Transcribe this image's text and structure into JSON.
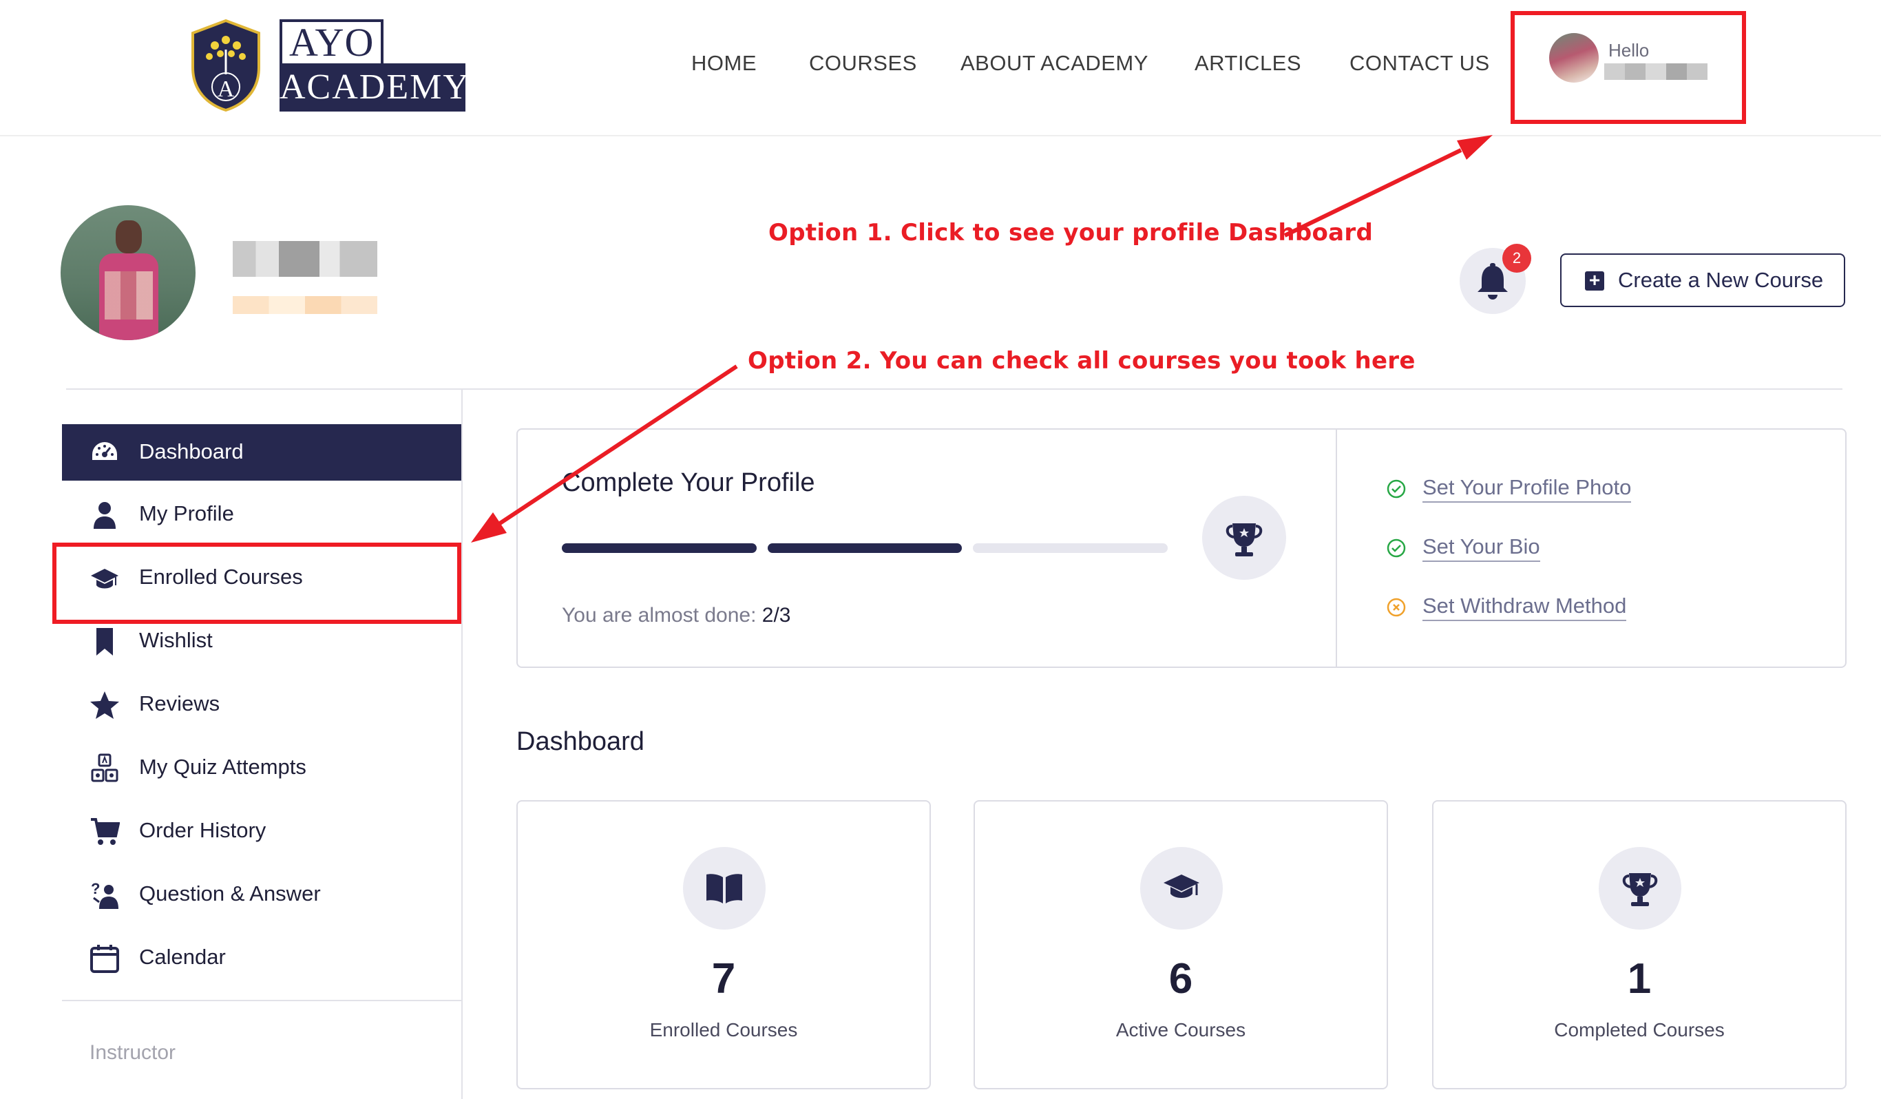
{
  "brand": {
    "line1": "AYO",
    "line2": "ACADEMY"
  },
  "nav": {
    "items": [
      "HOME",
      "COURSES",
      "ABOUT ACADEMY",
      "ARTICLES",
      "CONTACT US"
    ]
  },
  "user_menu": {
    "greeting": "Hello"
  },
  "annotations": {
    "option1": "Option 1. Click to see your profile Dashboard",
    "option2": "Option 2. You can check all courses you took here"
  },
  "notifications": {
    "count": "2",
    "icon": "bell-icon"
  },
  "actions": {
    "create_course": "Create a New Course"
  },
  "sidebar": {
    "items": [
      {
        "label": "Dashboard",
        "icon": "dashboard-gauge-icon",
        "active": true
      },
      {
        "label": "My Profile",
        "icon": "user-icon"
      },
      {
        "label": "Enrolled Courses",
        "icon": "graduation-cap-icon"
      },
      {
        "label": "Wishlist",
        "icon": "bookmark-icon"
      },
      {
        "label": "Reviews",
        "icon": "star-icon"
      },
      {
        "label": "My Quiz Attempts",
        "icon": "quiz-blocks-icon"
      },
      {
        "label": "Order History",
        "icon": "cart-icon"
      },
      {
        "label": "Question & Answer",
        "icon": "question-answer-icon"
      },
      {
        "label": "Calendar",
        "icon": "calendar-icon"
      }
    ],
    "section_label": "Instructor"
  },
  "profile_completion": {
    "title": "Complete Your Profile",
    "progress_done": 2,
    "progress_total": 3,
    "status_prefix": "You are almost done:",
    "status_value": "2/3",
    "checklist": [
      {
        "label": "Set Your Profile Photo",
        "status": "done",
        "color": "#27a745"
      },
      {
        "label": "Set Your Bio",
        "status": "done",
        "color": "#27a745"
      },
      {
        "label": "Set Withdraw Method",
        "status": "pending",
        "color": "#f0a12b"
      }
    ]
  },
  "dashboard": {
    "title": "Dashboard",
    "stats": [
      {
        "value": "7",
        "label": "Enrolled Courses",
        "icon": "open-book-icon"
      },
      {
        "value": "6",
        "label": "Active Courses",
        "icon": "graduation-cap-icon"
      },
      {
        "value": "1",
        "label": "Completed Courses",
        "icon": "trophy-icon"
      }
    ]
  },
  "colors": {
    "primary": "#26284f",
    "annotation_red": "#ea1d25",
    "track": "#e6e6ee"
  }
}
